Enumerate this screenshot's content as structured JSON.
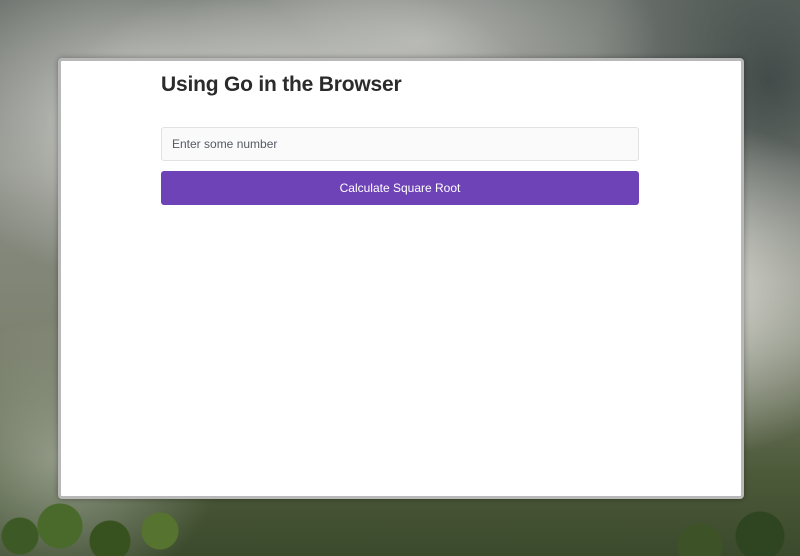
{
  "page": {
    "title": "Using Go in the Browser"
  },
  "form": {
    "input_placeholder": "Enter some number",
    "input_value": "",
    "button_label": "Calculate Square Root",
    "button_color": "#6f43b8"
  }
}
